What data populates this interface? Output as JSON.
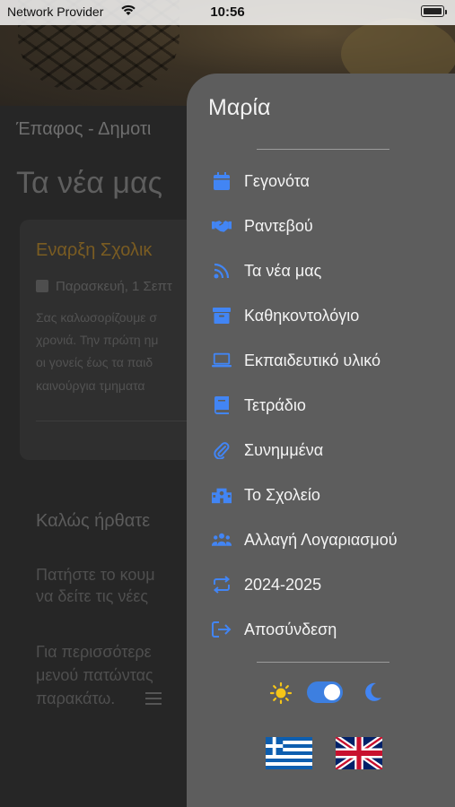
{
  "status_bar": {
    "carrier": "Network Provider",
    "time": "10:56"
  },
  "background": {
    "breadcrumb": "Έπαφος - Δημοτι",
    "title": "Τα νέα μας",
    "card": {
      "title": "Εναρξη Σχολικ",
      "date": "Παρασκευή, 1 Σεπτ",
      "lines": [
        "Σας καλωσορίζουμε σ",
        "χρονιά. Την πρώτη ημ",
        "οι γονείς έως τα παιδ",
        "καινούργια τμηματα"
      ]
    },
    "welcome": "Καλώς ήρθατε",
    "paragraph1": [
      "Πατήστε το κουμ",
      "να δείτε τις νέες"
    ],
    "paragraph2": [
      "Για περισσότερε",
      "μενού πατώντας",
      "παρακάτω."
    ]
  },
  "drawer": {
    "user_name": "Μαρία",
    "items": [
      {
        "label": "Γεγονότα",
        "icon": "calendar-icon"
      },
      {
        "label": "Ραντεβού",
        "icon": "handshake-icon"
      },
      {
        "label": "Τα νέα μας",
        "icon": "rss-icon"
      },
      {
        "label": "Καθηκοντολόγιο",
        "icon": "archive-box-icon"
      },
      {
        "label": "Εκπαιδευτικό υλικό",
        "icon": "laptop-icon"
      },
      {
        "label": "Τετράδιο",
        "icon": "book-icon"
      },
      {
        "label": "Συνημμένα",
        "icon": "paperclip-icon"
      },
      {
        "label": "Το Σχολείο",
        "icon": "school-icon"
      },
      {
        "label": "Αλλαγή Λογαριασμού",
        "icon": "users-icon"
      },
      {
        "label": "2024-2025",
        "icon": "repeat-icon"
      },
      {
        "label": "Αποσύνδεση",
        "icon": "logout-icon"
      }
    ],
    "theme": {
      "light_icon": "sun-icon",
      "dark_icon": "moon-icon",
      "dark_mode_on": true
    },
    "languages": [
      {
        "flag": "greek-flag"
      },
      {
        "flag": "uk-flag"
      }
    ]
  },
  "colors": {
    "accent": "#4285f4",
    "drawer_bg": "#5d5d5d",
    "sun": "#f5c518",
    "toggle": "#3d7fe0"
  }
}
